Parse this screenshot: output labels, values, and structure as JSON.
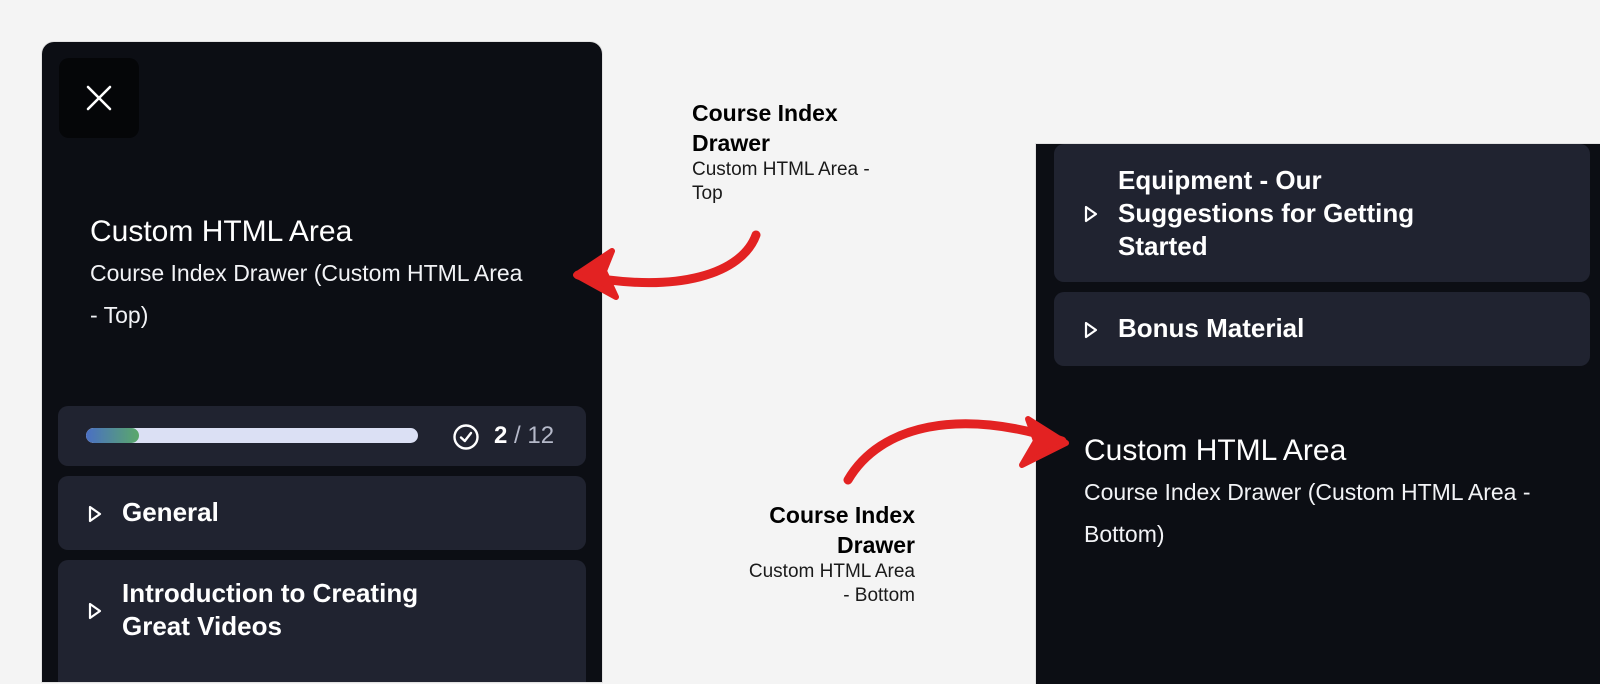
{
  "left_drawer": {
    "close_icon": "close-icon",
    "custom_area": {
      "title": "Custom HTML Area",
      "body": "Course Index Drawer (Custom HTML Area - Top)"
    },
    "progress": {
      "completed": "2",
      "separator": "/",
      "total": "12",
      "fraction": 0.16,
      "check_icon": "check-circle-icon"
    },
    "sections": [
      {
        "label": "General",
        "icon": "play-triangle-icon"
      },
      {
        "label": "Introduction to Creating Great Videos",
        "icon": "play-triangle-icon"
      }
    ]
  },
  "right_drawer": {
    "sections": [
      {
        "label": "Equipment - Our Suggestions for Getting Started",
        "icon": "play-triangle-icon"
      },
      {
        "label": "Bonus Material",
        "icon": "play-triangle-icon"
      }
    ],
    "custom_area": {
      "title": "Custom HTML Area",
      "body": "Course Index Drawer (Custom HTML Area - Bottom)"
    }
  },
  "annotations": {
    "top": {
      "title": "Course Index Drawer",
      "sub": "Custom HTML Area - Top"
    },
    "bottom": {
      "title": "Course Index Drawer",
      "sub": "Custom HTML Area - Bottom"
    }
  },
  "colors": {
    "drawer_bg": "#0c0e14",
    "card_bg": "#202330",
    "arrow": "#e32222",
    "progress_start": "#4a6fc4",
    "progress_end": "#5aa86a",
    "progress_track": "#dbe0f4"
  }
}
